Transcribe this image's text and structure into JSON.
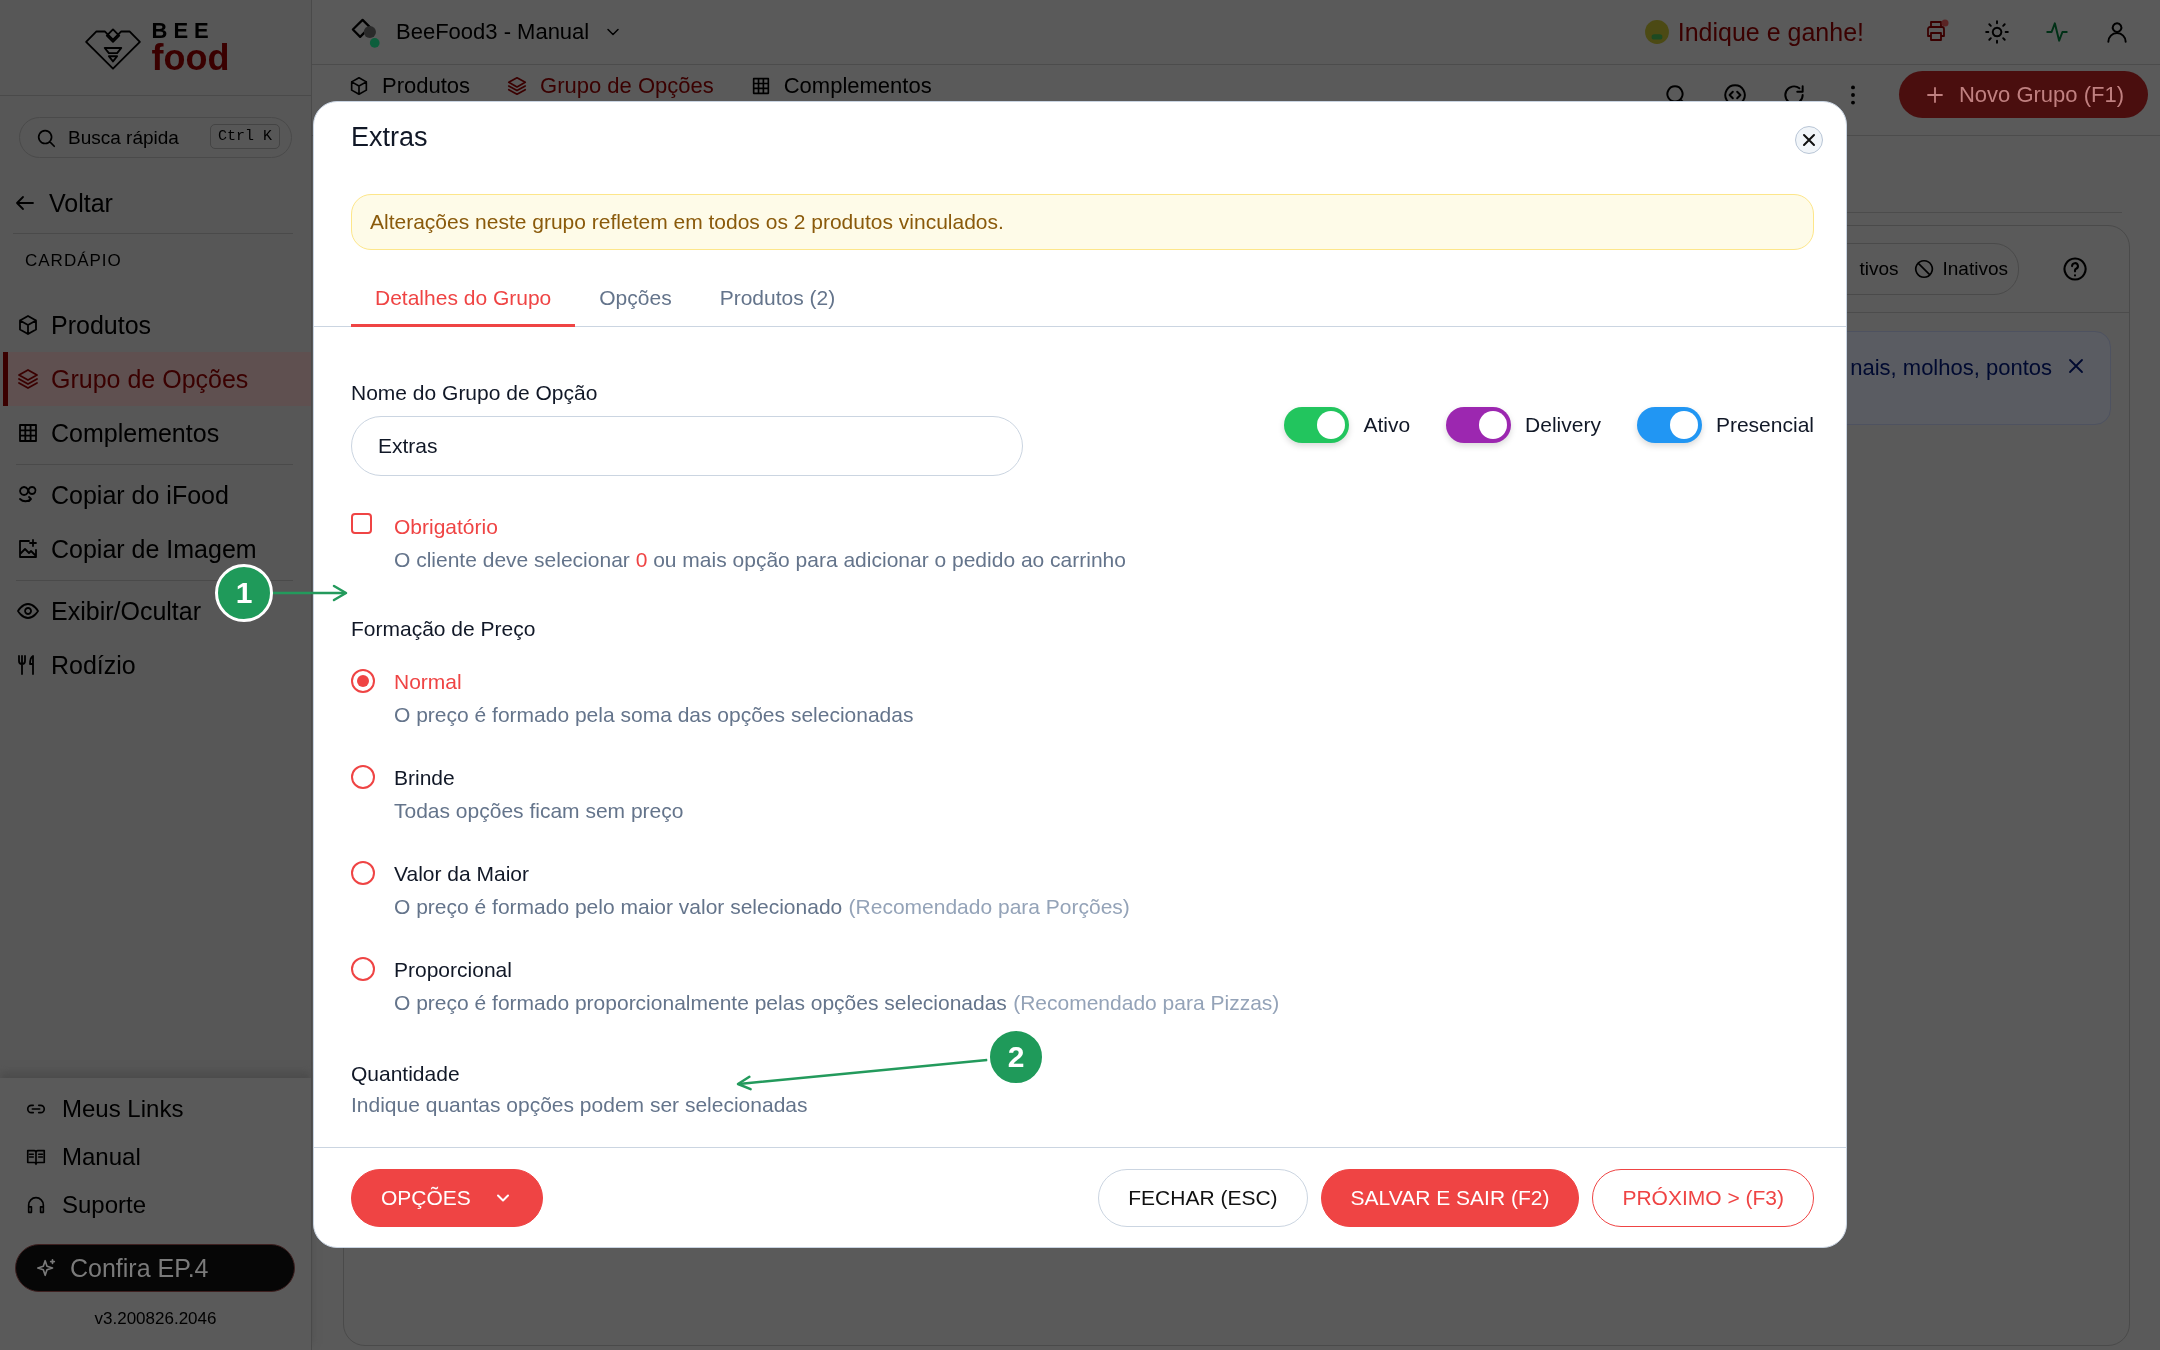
{
  "sidebar": {
    "logo": {
      "top": "BEE",
      "bottom": "food"
    },
    "search": {
      "placeholder": "Busca rápida",
      "shortcut": "Ctrl K"
    },
    "back": "Voltar",
    "section": "CARDÁPIO",
    "groups": [
      {
        "items": [
          {
            "label": "Produtos",
            "selected": false
          },
          {
            "label": "Grupo de Opções",
            "selected": true
          },
          {
            "label": "Complementos",
            "selected": false
          }
        ]
      },
      {
        "items": [
          {
            "label": "Copiar do iFood",
            "selected": false
          },
          {
            "label": "Copiar de Imagem",
            "selected": false
          }
        ]
      },
      {
        "items": [
          {
            "label": "Exibir/Ocultar",
            "selected": false
          },
          {
            "label": "Rodízio",
            "selected": false
          }
        ]
      }
    ],
    "footer_links": [
      {
        "label": "Meus Links"
      },
      {
        "label": "Manual"
      },
      {
        "label": "Suporte"
      }
    ],
    "promo": "Confira EP.4",
    "version": "v3.200826.2046"
  },
  "topbar": {
    "store": "BeeFood3 - Manual",
    "referral": "Indique e ganhe!"
  },
  "page": {
    "tabs": [
      {
        "label": "Produtos",
        "selected": false
      },
      {
        "label": "Grupo de Opções",
        "selected": true
      },
      {
        "label": "Complementos",
        "selected": false
      }
    ],
    "new_button": "Novo Grupo (F1)",
    "filter_partial": "tivos",
    "filter_inactive": "Inativos",
    "info_partial": "nais, molhos, pontos"
  },
  "modal": {
    "title": "Extras",
    "notice": "Alterações neste grupo refletem em todos os 2 produtos vinculados.",
    "tabs": [
      {
        "label": "Detalhes do Grupo",
        "selected": true
      },
      {
        "label": "Opções",
        "selected": false
      },
      {
        "label": "Produtos (2)",
        "selected": false
      }
    ],
    "name_label": "Nome do Grupo de Opção",
    "name_value": "Extras",
    "toggles": [
      {
        "label": "Ativo",
        "on": true,
        "color": "#22c55e"
      },
      {
        "label": "Delivery",
        "on": true,
        "color": "#9c27b0"
      },
      {
        "label": "Presencial",
        "on": true,
        "color": "#2196f3"
      }
    ],
    "required": {
      "label": "Obrigatório",
      "checked": false,
      "text_start": "O cliente deve selecionar",
      "min_count": "0",
      "text_end": "ou mais opção para adicionar o pedido ao carrinho"
    },
    "pricing": {
      "label": "Formação de Preço",
      "options": [
        {
          "label": "Normal",
          "description": "O preço é formado pela soma das opções selecionadas",
          "selected": true
        },
        {
          "label": "Brinde",
          "description": "Todas opções ficam sem preço",
          "selected": false
        },
        {
          "label": "Valor da Maior",
          "description": "O preço é formado pelo maior valor selecionado",
          "note": "(Recomendado para Porções)",
          "selected": false
        },
        {
          "label": "Proporcional",
          "description": "O preço é formado proporcionalmente pelas opções selecionadas",
          "note": "(Recomendado para Pizzas)",
          "selected": false
        }
      ]
    },
    "quantity": {
      "label": "Quantidade",
      "description": "Indique quantas opções podem ser selecionadas"
    },
    "options_button": "OPÇÕES",
    "close_button": "FECHAR (ESC)",
    "save_button": "SALVAR E SAIR (F2)",
    "next_button": "PRÓXIMO > (F3)"
  },
  "annotations": [
    {
      "label": "1"
    },
    {
      "label": "2"
    }
  ]
}
